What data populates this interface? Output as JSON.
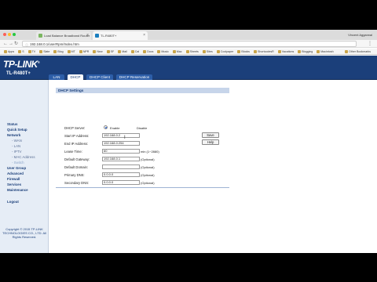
{
  "browser": {
    "tabs": [
      {
        "label": "Load Balance Broadband Router",
        "active": false
      },
      {
        "label": "TL-R480T+",
        "active": true
      }
    ],
    "user": "Vincent Aggarwal",
    "url": "192.168.0.1/userRpm/Index.htm",
    "bookmarks": [
      "Apps",
      "S",
      "TV",
      "Slate",
      "Blog",
      "MT",
      "NPR",
      "New",
      "SF",
      "Mail",
      "Cal",
      "Docs",
      "Music",
      "Mac",
      "Sheets",
      "Sites",
      "Coolpaper",
      "Blocks",
      "ShortcodesR",
      "Vacations",
      "Blogging",
      "Macintosh"
    ],
    "other_bookmarks": "Other Bookmarks"
  },
  "router": {
    "logo": "TP-LINK",
    "model": "TL-R480T+",
    "subtabs": [
      "LAN",
      "DHCP",
      "DHCP Client",
      "DHCP Reservation"
    ],
    "active_subtab": 1,
    "sidebar": [
      {
        "label": "Status",
        "sub": false
      },
      {
        "label": "Quick Setup",
        "sub": false
      },
      {
        "label": "Network",
        "sub": false
      },
      {
        "label": "- WAN",
        "sub": true
      },
      {
        "label": "- LAN",
        "sub": true
      },
      {
        "label": "- IPTV",
        "sub": true
      },
      {
        "label": "- MAC Address",
        "sub": true
      },
      {
        "label": "- Switch",
        "sub": true
      },
      {
        "label": "User Group",
        "sub": false
      },
      {
        "label": "Advanced",
        "sub": false
      },
      {
        "label": "Firewall",
        "sub": false
      },
      {
        "label": "Services",
        "sub": false
      },
      {
        "label": "Maintenance",
        "sub": false
      },
      {
        "label": "Logout",
        "sub": false
      }
    ],
    "copyright": "Copyright © 2015 TP-LINK TECHNOLOGIES CO., LTD. All Rights Reserved.",
    "dhcp": {
      "section_title": "DHCP Settings",
      "server_label": "DHCP Server:",
      "enable_label": "Enable",
      "disable_label": "Disable",
      "server_enabled": true,
      "start_ip_label": "Start IP Address:",
      "start_ip": "192.168.0.2",
      "end_ip_label": "End IP Address:",
      "end_ip": "192.168.0.254",
      "lease_label": "Lease Time:",
      "lease": "60",
      "lease_note": "min (1~2880)",
      "gateway_label": "Default Gateway:",
      "gateway": "192.168.0.1",
      "domain_label": "Default Domain:",
      "domain": "",
      "primary_dns_label": "Primary DNS:",
      "primary_dns": "0.0.0.0",
      "secondary_dns_label": "Secondary DNS:",
      "secondary_dns": "0.0.0.0",
      "optional_label": "(Optional)",
      "save_label": "Save",
      "help_label": "Help"
    }
  },
  "colors": {
    "header_blue": "#1b3f7a",
    "active_subtab": "#ffffff",
    "subtab_blue": "#2d5ea8",
    "sidebar_bg": "#e6edf6",
    "section_bar": "#c7d5ea"
  }
}
